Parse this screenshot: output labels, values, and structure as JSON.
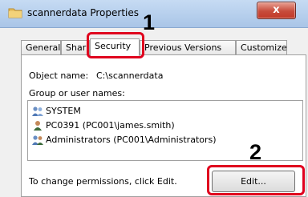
{
  "window": {
    "title": "scannerdata Properties",
    "close_glyph": "x"
  },
  "tabs": [
    {
      "label": "General"
    },
    {
      "label": "Sharing"
    },
    {
      "label": "Security"
    },
    {
      "label": "Previous Versions"
    },
    {
      "label": "Customize"
    }
  ],
  "security": {
    "object_name_label": "Object name:",
    "object_name_value": "C:\\scannerdata",
    "group_label": "Group or user names:",
    "users": [
      {
        "name": "SYSTEM"
      },
      {
        "name": "PC0391 (PC001\\james.smith)"
      },
      {
        "name": "Administrators (PC001\\Administrators)"
      }
    ],
    "change_permissions_text": "To change permissions, click Edit.",
    "edit_button_label": "Edit..."
  },
  "callouts": {
    "step1": "1",
    "step2": "2",
    "color": "#e0001e"
  },
  "icons": {
    "title": "folder-icon",
    "users": [
      "user-group-icon",
      "user-icon",
      "user-group-icon"
    ]
  }
}
